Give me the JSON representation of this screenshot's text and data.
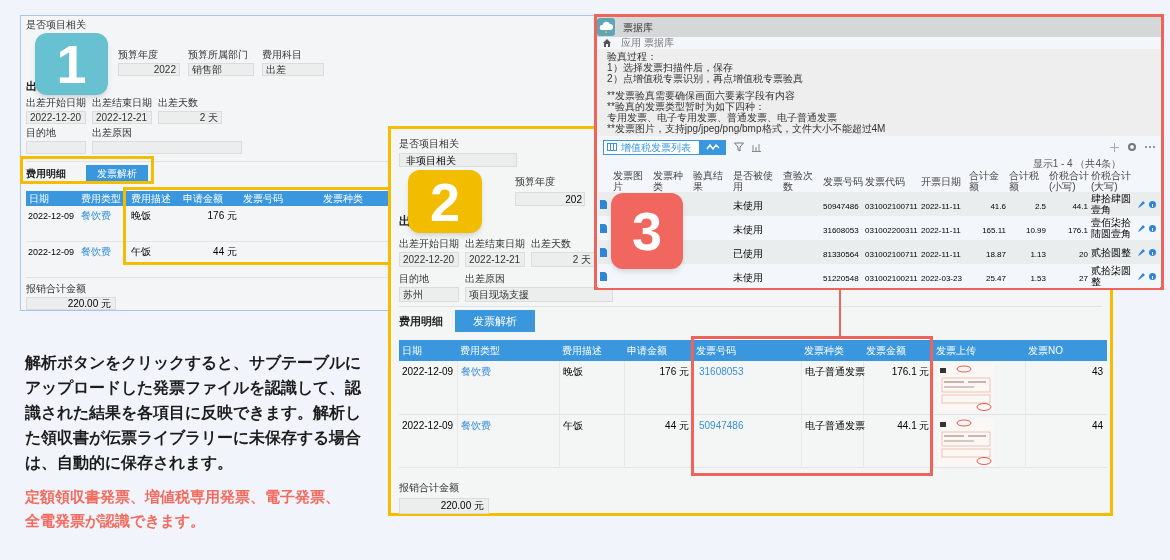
{
  "panel_1": {
    "badge": "1",
    "project_label": "是否项目相关",
    "heading": "出",
    "budget_fields": [
      {
        "label": "预算年度",
        "value": "2022"
      },
      {
        "label": "预算所属部门",
        "value": "销售部"
      },
      {
        "label": "费用科目",
        "value": "出差"
      }
    ],
    "trip_fields": [
      {
        "label": "出差开始日期",
        "value": "2022-12-20"
      },
      {
        "label": "出差结束日期",
        "value": "2022-12-21"
      },
      {
        "label": "出差天数",
        "value": "2 天"
      }
    ],
    "place_labels": [
      "目的地",
      "出差原因"
    ],
    "section_title": "费用明细",
    "parse_button": "发票解析",
    "columns": [
      "日期",
      "费用类型",
      "费用描述",
      "申请金额",
      "发票号码",
      "发票种类"
    ],
    "rows": [
      {
        "date": "2022-12-09",
        "type": "餐饮费",
        "description": "晚饭",
        "amount": "176 元"
      },
      {
        "date": "2022-12-09",
        "type": "餐饮费",
        "description": "午饭",
        "amount": "44 元"
      }
    ],
    "total_label": "报销合计金额",
    "total_value": "220.00 元"
  },
  "panel_2": {
    "badge": "2",
    "project_label": "是否项目相关",
    "project_value": "非项目相关",
    "budget_label": "预算年度",
    "budget_value": "202",
    "heading": "出",
    "trip_fields": [
      {
        "label": "出差开始日期",
        "value": "2022-12-20"
      },
      {
        "label": "出差结束日期",
        "value": "2022-12-21"
      },
      {
        "label": "出差天数",
        "value": "2 天"
      }
    ],
    "place_fields": [
      {
        "label": "目的地",
        "value": "苏州"
      },
      {
        "label": "出差原因",
        "value": "项目现场支援"
      }
    ],
    "section_title": "费用明细",
    "parse_button": "发票解析",
    "columns": [
      "日期",
      "费用类型",
      "费用描述",
      "申请金额",
      "发票号码",
      "发票种类",
      "发票金额",
      "发票上传",
      "发票NO"
    ],
    "rows": [
      {
        "date": "2022-12-09",
        "type": "餐饮费",
        "description": "晚饭",
        "amount": "176 元",
        "invoice_no": "31608053",
        "invoice_kind": "电子普通发票",
        "invoice_amount": "176.1 元",
        "no": "43"
      },
      {
        "date": "2022-12-09",
        "type": "餐饮费",
        "description": "午饭",
        "amount": "44 元",
        "invoice_no": "50947486",
        "invoice_kind": "电子普通发票",
        "invoice_amount": "44.1 元",
        "no": "44"
      }
    ],
    "total_label": "报销合计金额",
    "total_value": "220.00 元"
  },
  "panel_3": {
    "badge": "3",
    "title": "票据库",
    "breadcrumb": "应用 票据库",
    "description": [
      "验真过程：",
      "1）选择发票扫描件后，保存",
      "2）点增值税专票识别，再点增值税专票验真",
      "**发票验真需要确保画面六要素字段有内容",
      "**验真的发票类型暂时为如下四种：",
      "专用发票、电子专用发票、普通发票、电子普通发票",
      "**发票图片，支持jpg/jpeg/png/bmp格式，文件大小不能超过4M"
    ],
    "view_name": "增值税发票列表",
    "count": "显示1 - 4 （共4条）",
    "columns": [
      "发票图片",
      "发票种类",
      "验真结果",
      "是否被使用",
      "查验次数",
      "发票号码",
      "发票代码",
      "开票日期",
      "合计金额",
      "合计税额",
      "价税合计(小写)",
      "价税合计(大写)"
    ],
    "rows": [
      {
        "used": "未使用",
        "number": "50947486",
        "code": "031002100711",
        "date": "2022-11-11",
        "amount": "41.6",
        "tax": "2.5",
        "total": "44.1",
        "total_words": "肆拾肆圆壹角"
      },
      {
        "used": "未使用",
        "number": "31608053",
        "code": "031002200311",
        "date": "2022-11-11",
        "amount": "165.11",
        "tax": "10.99",
        "total": "176.1",
        "total_words": "壹佰柒拾陆圆壹角"
      },
      {
        "used": "已使用",
        "number": "81330564",
        "code": "031002100711",
        "date": "2022-11-11",
        "amount": "18.87",
        "tax": "1.13",
        "total": "20",
        "total_words": "贰拾圆整"
      },
      {
        "used": "未使用",
        "number": "51220548",
        "code": "031002100211",
        "date": "2022-03-23",
        "amount": "25.47",
        "tax": "1.53",
        "total": "27",
        "total_words": "贰拾柒圆整"
      }
    ]
  },
  "explanation": "解析ボタンをクリックすると、サブテーブルにアップロードした発票ファイルを認識して、認識された結果を各項目に反映できます。解析した領収書が伝票ライブラリーに未保存する場合は、自動的に保存されます。",
  "highlight": "定額領収書発票、増値税専用発票、電子発票、全電発票が認識できます。"
}
